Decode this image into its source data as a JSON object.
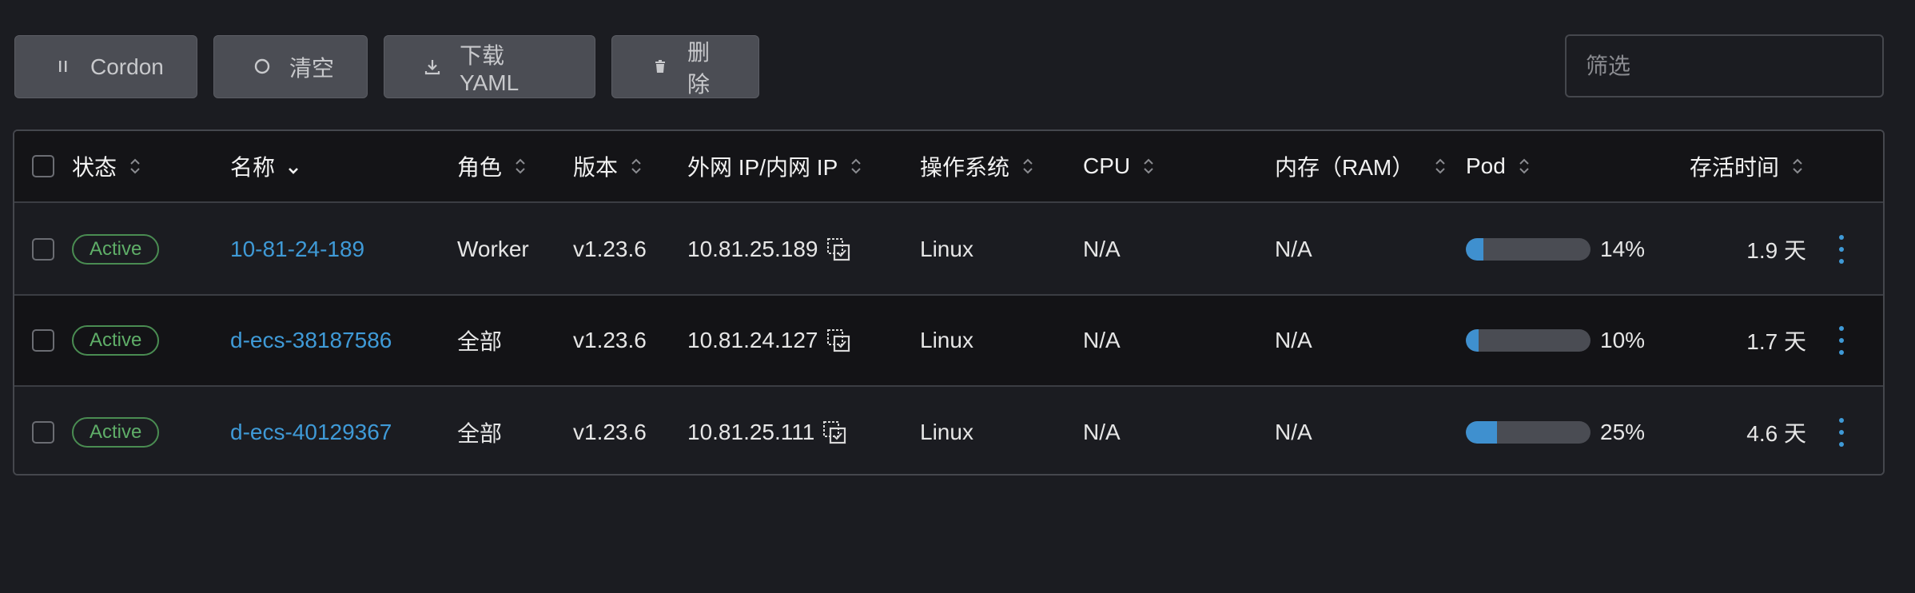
{
  "toolbar": {
    "cordon_label": "Cordon",
    "clear_label": "清空",
    "download_label": "下载 YAML",
    "delete_label": "删除"
  },
  "filter": {
    "placeholder": "筛选",
    "value": ""
  },
  "table": {
    "columns": [
      "状态",
      "名称",
      "角色",
      "版本",
      "外网 IP/内网 IP",
      "操作系统",
      "CPU",
      "内存（RAM）",
      "Pod",
      "存活时间"
    ],
    "rows": [
      {
        "state": "Active",
        "name": "10-81-24-189",
        "role": "Worker",
        "version": "v1.23.6",
        "ip": "10.81.25.189",
        "os": "Linux",
        "cpu": "N/A",
        "memory": "N/A",
        "pod_percent": 14,
        "pod_label": "14%",
        "age": "1.9 天"
      },
      {
        "state": "Active",
        "name": "d-ecs-38187586",
        "role": "全部",
        "version": "v1.23.6",
        "ip": "10.81.24.127",
        "os": "Linux",
        "cpu": "N/A",
        "memory": "N/A",
        "pod_percent": 10,
        "pod_label": "10%",
        "age": "1.7 天"
      },
      {
        "state": "Active",
        "name": "d-ecs-40129367",
        "role": "全部",
        "version": "v1.23.6",
        "ip": "10.81.25.111",
        "os": "Linux",
        "cpu": "N/A",
        "memory": "N/A",
        "pod_percent": 25,
        "pod_label": "25%",
        "age": "4.6 天"
      }
    ]
  },
  "colors": {
    "background": "#1b1c21",
    "accent": "#3f9ad7",
    "active_badge": "#5fae68",
    "button_bg": "#4b4d54"
  },
  "icons": {
    "cordon": "pause-icon",
    "clear": "circle-icon",
    "download": "download-icon",
    "delete": "trash-icon",
    "copy": "copy-icon",
    "sort": "sort-icon",
    "menu": "kebab-menu-icon"
  }
}
